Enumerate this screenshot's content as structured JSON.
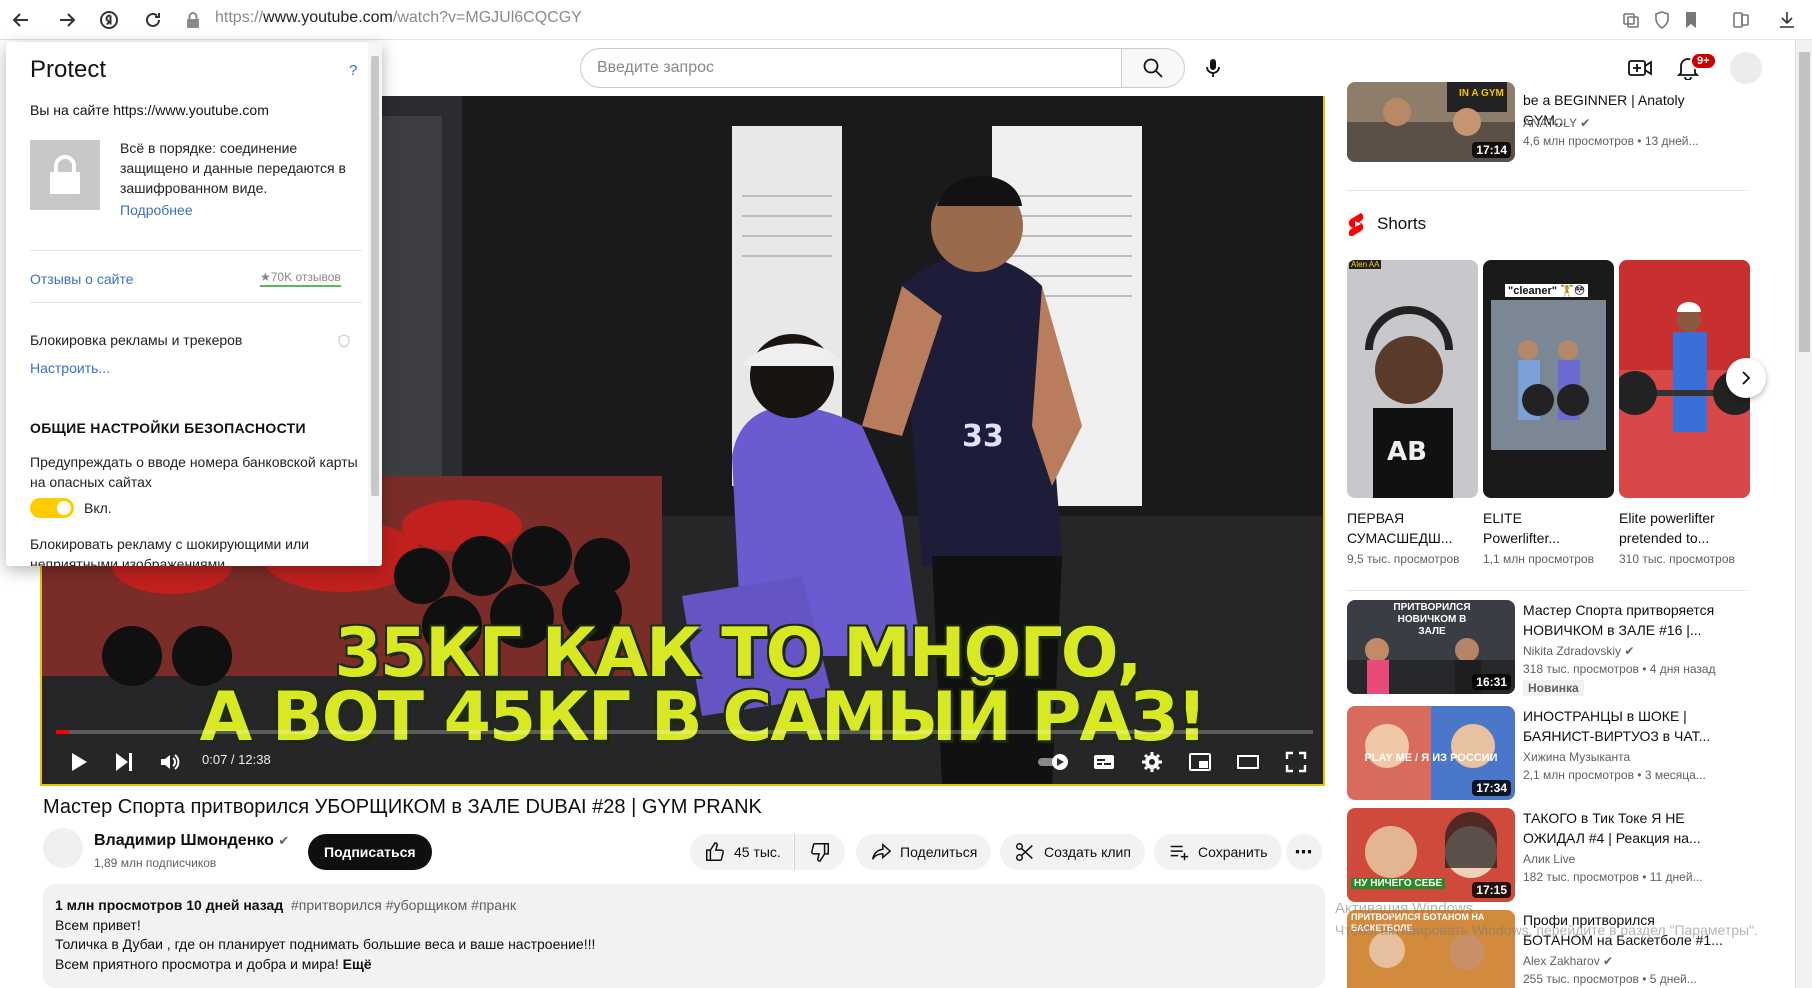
{
  "browser": {
    "url_scheme": "https://",
    "url_host": "www.youtube.com",
    "url_path": "/watch?v=MGJUl6CQCGY"
  },
  "youtube_header": {
    "search_placeholder": "Введите запрос",
    "notification_count": "9+"
  },
  "player": {
    "caption_line1": "35КГ КАК ТО МНОГО,",
    "caption_line2": "А ВОТ 45КГ В САМЫЙ РАЗ!",
    "jersey_number": "33",
    "time": "0:07 / 12:38",
    "progress": 0.01
  },
  "video": {
    "title": "Мастер Спорта притворился УБОРЩИКОМ в ЗАЛЕ DUBAI #28 | GYM PRANK",
    "channel": "Владимир Шмонденко",
    "subscribers": "1,89 млн подписчиков",
    "subscribe_label": "Подписаться",
    "likes": "45 тыс.",
    "share_label": "Поделиться",
    "clip_label": "Создать клип",
    "save_label": "Сохранить",
    "description": {
      "stats": "1 млн просмотров  10 дней назад",
      "tags": "#притворился #уборщиком #пранк",
      "line1": "Всем привет!",
      "line2": "Толичка в Дубаи , где он планирует поднимать большие веса и ваше настроение!!!",
      "line3": "Всем приятного просмотра и добра и мира!",
      "more": "Ещё"
    }
  },
  "sidebar": {
    "top_video": {
      "title": "be a BEGINNER | Anatoly GYM...",
      "channel": "ANATOLY",
      "meta": "4,6 млн просмотров  • 13 дней...",
      "duration": "17:14",
      "thumb_text": "IN A GYM"
    },
    "shorts_title": "Shorts",
    "shorts": [
      {
        "title1": "ПЕРВАЯ",
        "title2": "СУМАСШЕДШ...",
        "views": "9,5 тыс. просмотров",
        "thumb_text": "Alen AA"
      },
      {
        "title1": "ELITE",
        "title2": "Powerlifter...",
        "views": "1,1 млн просмотров",
        "thumb_text": "\"cleaner\" 🏋️😳"
      },
      {
        "title1": "Elite powerlifter",
        "title2": "pretended to...",
        "views": "310 тыс. просмотров",
        "thumb_text": ""
      }
    ],
    "videos": [
      {
        "title": "Мастер Спорта притворяется НОВИЧКОМ в ЗАЛЕ #16 |...",
        "channel": "Nikita Zdradovskiy",
        "meta": "318 тыс. просмотров  • 4 дня назад",
        "badge": "Новинка",
        "duration": "16:31",
        "thumb_text": "ПРИТВОРИЛСЯ НОВИЧКОМ В ЗАЛЕ"
      },
      {
        "title": "ИНОСТРАНЦЫ в ШОКЕ | БАЯНИСТ-ВИРТУОЗ в ЧАТ...",
        "channel": "Хижина Музыканта",
        "meta": "2,1 млн просмотров  • 3 месяца...",
        "badge": "",
        "duration": "17:34",
        "thumb_text": "PLAY ME / Я ИЗ РОССИИ"
      },
      {
        "title": "ТАКОГО в Тик Токе Я НЕ ОЖИДАЛ #4 | Реакция на...",
        "channel": "Алик Live",
        "meta": "182 тыс. просмотров  • 11 дней...",
        "badge": "",
        "duration": "17:15",
        "thumb_text": "НУ НИЧЕГО СЕБЕ"
      },
      {
        "title": "Профи притворился БОТАНОМ на Баскетболе #1...",
        "channel": "Alex Zakharov",
        "meta": "255 тыс. просмотров  • 5 дней...",
        "badge": "",
        "duration": "",
        "thumb_text": "ПРИТВОРИЛСЯ БОТАНОМ НА БАСКЕТБОЛЕ"
      }
    ]
  },
  "watermark": {
    "line1": "Активация Windows",
    "line2": "Чтобы активировать Windows, перейдите в раздел \"Параметры\"."
  },
  "protect": {
    "title": "Protect",
    "help": "?",
    "site_line": "Вы на сайте https://www.youtube.com",
    "ok_text": "Всё в порядке: соединение защищено и данные передаются в зашифрованном виде.",
    "more_link": "Подробнее",
    "reviews_link": "Отзывы о сайте",
    "reviews_count": "★70K отзывов",
    "adblock_label": "Блокировка рекламы и трекеров",
    "configure_link": "Настроить...",
    "section_title": "ОБЩИЕ НАСТРОЙКИ БЕЗОПАСНОСТИ",
    "card_warning": "Предупреждать о вводе номера банковской карты на опасных сайтах",
    "toggle_state": "Вкл.",
    "toggle_on": true,
    "shock_ads": "Блокировать рекламу с шокирующими или неприятными изображениями"
  }
}
